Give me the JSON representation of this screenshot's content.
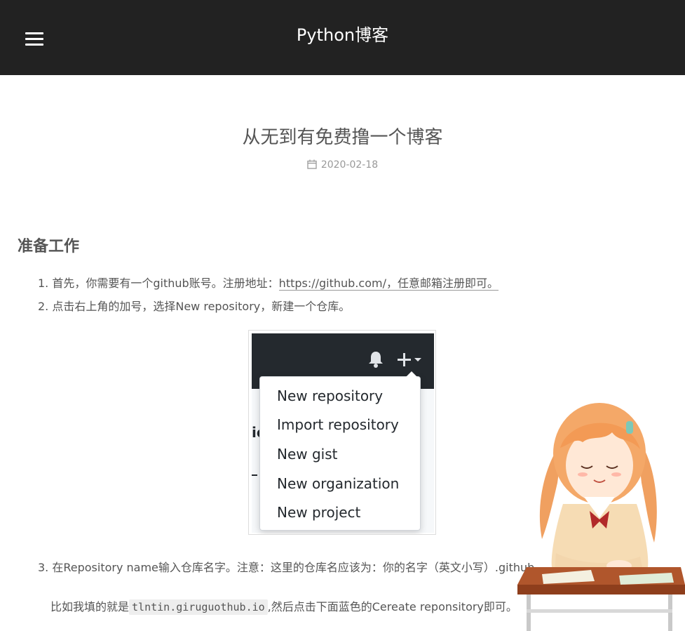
{
  "header": {
    "site_title": "Python博客",
    "menu_icon": "hamburger-menu-icon"
  },
  "post": {
    "title": "从无到有免费撸一个博客",
    "date": "2020-02-18",
    "date_icon": "calendar-icon"
  },
  "section": {
    "heading": "准备工作"
  },
  "steps": {
    "item1_prefix": "1. 首先，你需要有一个github账号。注册地址：",
    "item1_link": "https://github.com/，任意邮箱注册即可。",
    "item2": "2. 点击右上角的加号，选择New repository，新建一个仓库。",
    "item3": "3. 在Repository name输入仓库名字。注意：这里的仓库名应该为：你的名字（英文小写）.github",
    "item3_sub_prefix": "比如我填的就是",
    "item3_code": "tlntin.giruguothub.io",
    "item3_sub_suffix": ",然后点击下面蓝色的Cereate reponsitory即可。"
  },
  "screenshot": {
    "menu_items": [
      "New repository",
      "Import repository",
      "New gist",
      "New organization",
      "New project"
    ],
    "edge_text": "ie"
  },
  "colors": {
    "header_bg": "#222222",
    "github_bar": "#24292e",
    "text": "#555555",
    "meta": "#999999"
  }
}
